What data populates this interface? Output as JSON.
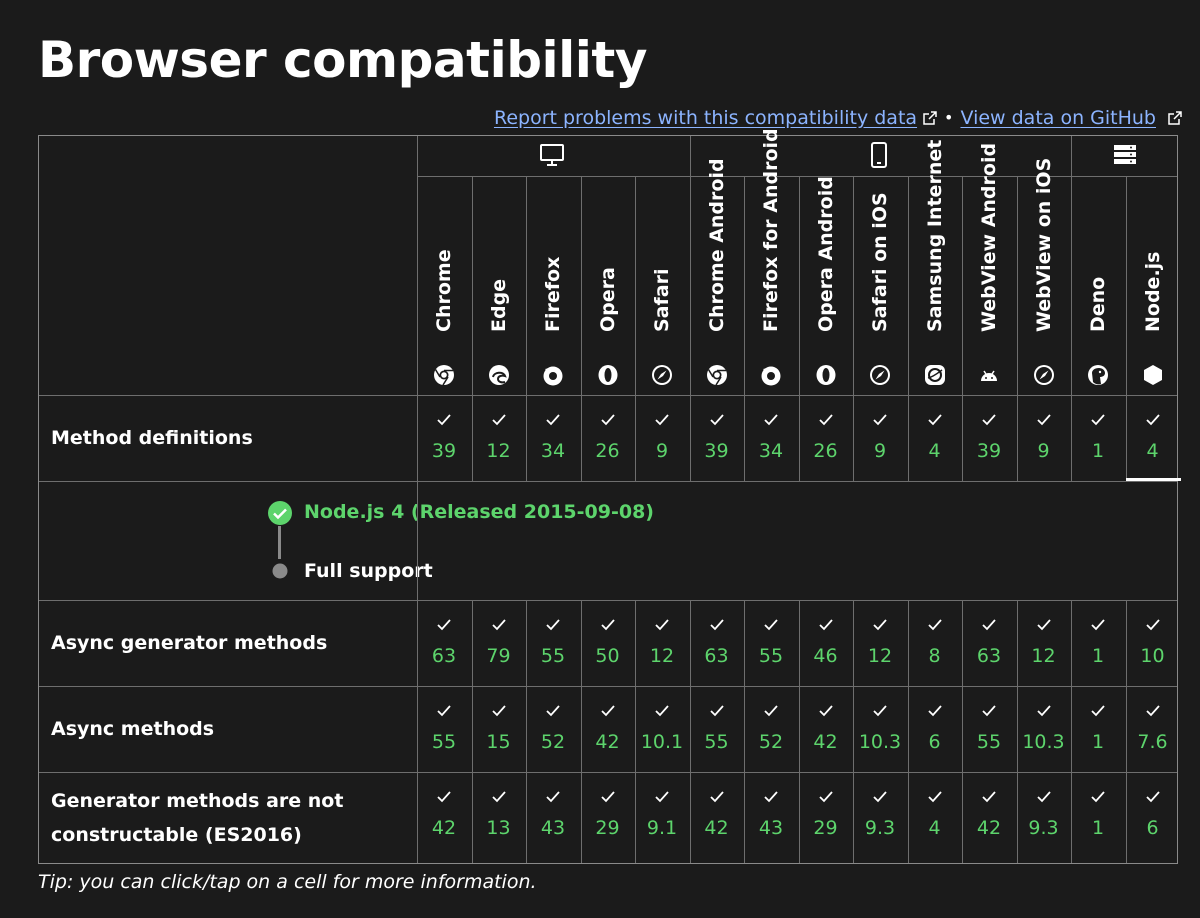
{
  "title": "Browser compatibility",
  "links": {
    "report": "Report problems with this compatibility data",
    "separator": "•",
    "github": "View data on GitHub"
  },
  "groups": [
    {
      "icon": "desktop-icon"
    },
    {
      "icon": "mobile-icon"
    },
    {
      "icon": "server-icon"
    }
  ],
  "browsers": [
    {
      "name": "Chrome",
      "icon": "chrome-logo-icon"
    },
    {
      "name": "Edge",
      "icon": "edge-logo-icon"
    },
    {
      "name": "Firefox",
      "icon": "firefox-logo-icon"
    },
    {
      "name": "Opera",
      "icon": "opera-logo-icon"
    },
    {
      "name": "Safari",
      "icon": "safari-logo-icon"
    },
    {
      "name": "Chrome Android",
      "icon": "chrome-logo-icon"
    },
    {
      "name": "Firefox for Android",
      "icon": "firefox-logo-icon"
    },
    {
      "name": "Opera Android",
      "icon": "opera-logo-icon"
    },
    {
      "name": "Safari on iOS",
      "icon": "safari-logo-icon"
    },
    {
      "name": "Samsung Internet",
      "icon": "samsung-logo-icon"
    },
    {
      "name": "WebView Android",
      "icon": "android-logo-icon"
    },
    {
      "name": "WebView on iOS",
      "icon": "safari-logo-icon"
    },
    {
      "name": "Deno",
      "icon": "deno-logo-icon"
    },
    {
      "name": "Node.js",
      "icon": "nodejs-logo-icon"
    }
  ],
  "rows": [
    {
      "label": "Method definitions",
      "versions": [
        "39",
        "12",
        "34",
        "26",
        "9",
        "39",
        "34",
        "26",
        "9",
        "4",
        "39",
        "9",
        "1",
        "4"
      ]
    },
    {
      "label": "Async generator methods",
      "versions": [
        "63",
        "79",
        "55",
        "50",
        "12",
        "63",
        "55",
        "46",
        "12",
        "8",
        "63",
        "12",
        "1",
        "10"
      ]
    },
    {
      "label": "Async methods",
      "versions": [
        "55",
        "15",
        "52",
        "42",
        "10.1",
        "55",
        "52",
        "42",
        "10.3",
        "6",
        "55",
        "10.3",
        "1",
        "7.6"
      ]
    },
    {
      "label": "Generator methods are not constructable (ES2016)",
      "label_lines": [
        "Generator methods are not",
        "constructable (ES2016)"
      ],
      "versions": [
        "42",
        "13",
        "43",
        "29",
        "9.1",
        "42",
        "43",
        "29",
        "9.3",
        "4",
        "42",
        "9.3",
        "1",
        "6"
      ]
    }
  ],
  "detail": {
    "release": "Node.js 4 (Released 2015-09-08)",
    "status": "Full support"
  },
  "tip": "Tip: you can click/tap on a cell for more information.",
  "colors": {
    "background": "#1b1b1b",
    "link": "#8cb4ff",
    "supported": "#5dd46c",
    "border": "#6e6e6e"
  }
}
